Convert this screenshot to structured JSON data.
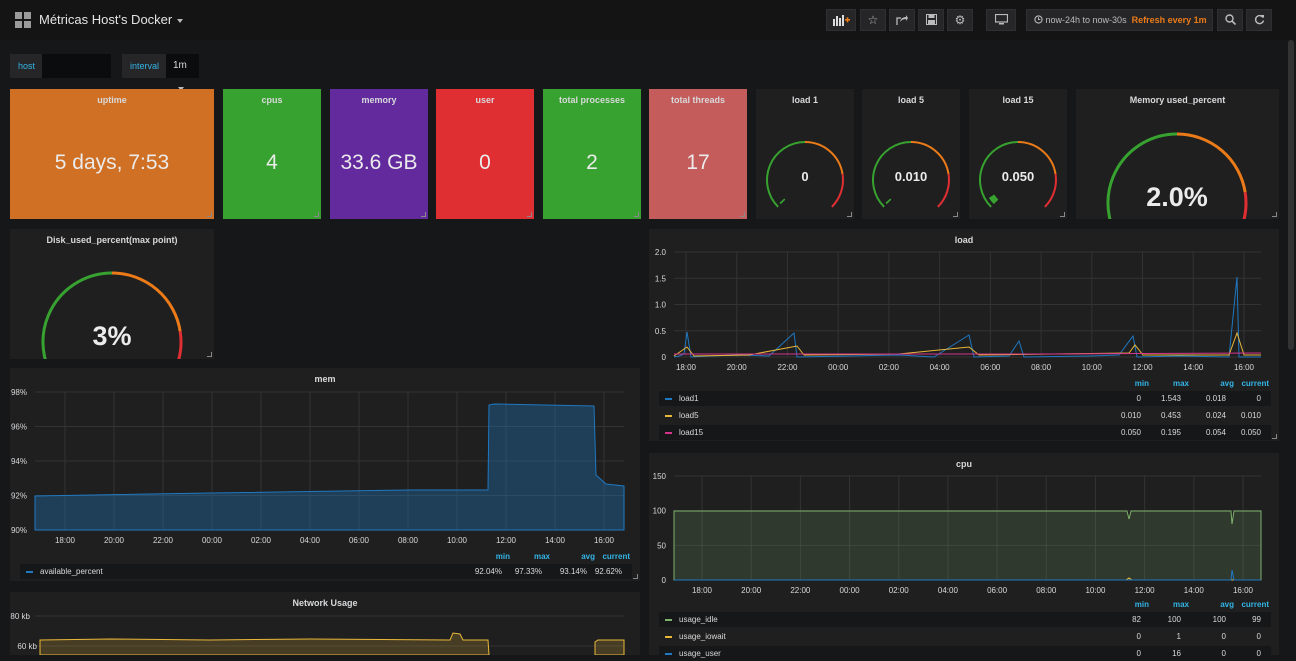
{
  "header": {
    "title": "Métricas Host's Docker",
    "time_range": "now-24h to now-30s",
    "refresh": "Refresh every 1m"
  },
  "variables": [
    {
      "label": "host",
      "value": ""
    },
    {
      "label": "interval",
      "value": "1m"
    }
  ],
  "stats": [
    {
      "title": "uptime",
      "value": "5 days, 7:53",
      "color": "#d07024"
    },
    {
      "title": "cpus",
      "value": "4",
      "color": "#37a22f"
    },
    {
      "title": "memory",
      "value": "33.6 GB",
      "color": "#622a9d"
    },
    {
      "title": "user",
      "value": "0",
      "color": "#e02f33"
    },
    {
      "title": "total processes",
      "value": "2",
      "color": "#37a22f"
    },
    {
      "title": "total threads",
      "value": "17",
      "color": "#c45c5c"
    }
  ],
  "gauges": [
    {
      "title": "load 1",
      "value": "0",
      "level": 0
    },
    {
      "title": "load 5",
      "value": "0.010",
      "level": 0.01
    },
    {
      "title": "load 15",
      "value": "0.050",
      "level": 0.05
    },
    {
      "title": "Memory used_percent",
      "value": "2.0%",
      "level": 0.02
    },
    {
      "title": "Disk_used_percent(max point)",
      "value": "3%",
      "level": 0.03
    }
  ],
  "chart_data": [
    {
      "type": "line",
      "title": "load",
      "x": [
        "18:00",
        "20:00",
        "22:00",
        "00:00",
        "02:00",
        "04:00",
        "06:00",
        "08:00",
        "10:00",
        "12:00",
        "14:00",
        "16:00"
      ],
      "yticks": [
        "2.0",
        "1.5",
        "1.0",
        "0.5",
        "0"
      ],
      "ylim": [
        0,
        2.0
      ],
      "legend_headers": [
        "min",
        "max",
        "avg",
        "current"
      ],
      "series": [
        {
          "name": "load1",
          "color": "#1f78c1",
          "stats": [
            "0",
            "1.543",
            "0.018",
            "0"
          ]
        },
        {
          "name": "load5",
          "color": "#eab839",
          "stats": [
            "0.010",
            "0.453",
            "0.024",
            "0.010"
          ]
        },
        {
          "name": "load15",
          "color": "#d6338e",
          "stats": [
            "0.050",
            "0.195",
            "0.054",
            "0.050"
          ]
        }
      ]
    },
    {
      "type": "area",
      "title": "mem",
      "x": [
        "18:00",
        "20:00",
        "22:00",
        "00:00",
        "02:00",
        "04:00",
        "06:00",
        "08:00",
        "10:00",
        "12:00",
        "14:00",
        "16:00"
      ],
      "yticks": [
        "98%",
        "96%",
        "94%",
        "92%",
        "90%"
      ],
      "ylim": [
        90,
        98
      ],
      "legend_headers": [
        "min",
        "max",
        "avg",
        "current"
      ],
      "series": [
        {
          "name": "available_percent",
          "color": "#1f78c1",
          "stats": [
            "92.04%",
            "97.33%",
            "93.14%",
            "92.62%"
          ]
        }
      ]
    },
    {
      "type": "line",
      "title": "cpu",
      "x": [
        "18:00",
        "20:00",
        "22:00",
        "00:00",
        "02:00",
        "04:00",
        "06:00",
        "08:00",
        "10:00",
        "12:00",
        "14:00",
        "16:00"
      ],
      "yticks": [
        "150",
        "100",
        "50",
        "0"
      ],
      "ylim": [
        0,
        150
      ],
      "legend_headers": [
        "min",
        "max",
        "avg",
        "current"
      ],
      "series": [
        {
          "name": "usage_idle",
          "color": "#7eb26d",
          "stats": [
            "82",
            "100",
            "100",
            "99"
          ]
        },
        {
          "name": "usage_iowait",
          "color": "#eab839",
          "stats": [
            "0",
            "1",
            "0",
            "0"
          ]
        },
        {
          "name": "usage_user",
          "color": "#1f78c1",
          "stats": [
            "0",
            "16",
            "0",
            "0"
          ]
        }
      ]
    },
    {
      "type": "line",
      "title": "Network Usage",
      "yticks": [
        "80 kb",
        "60 kb"
      ]
    }
  ]
}
